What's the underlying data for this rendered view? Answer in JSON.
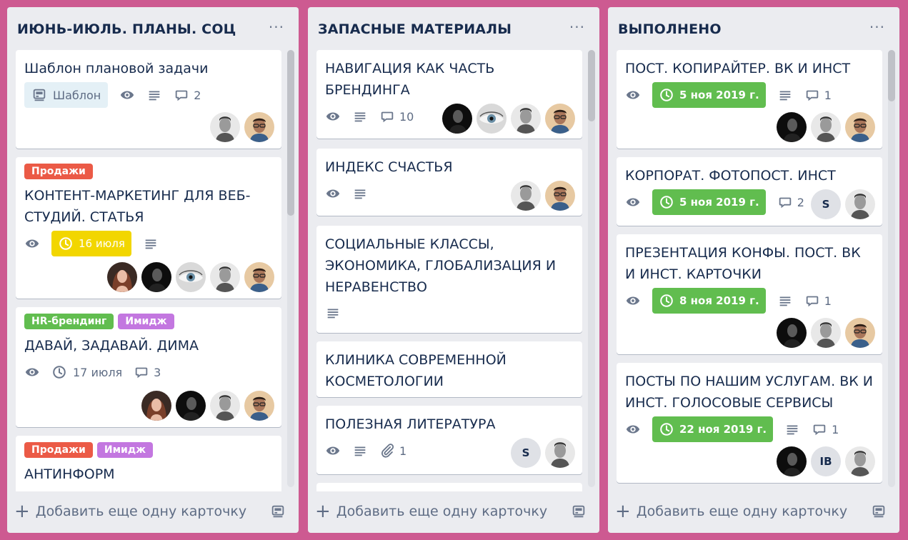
{
  "lists": [
    {
      "title": "ИЮНЬ-ИЮЛЬ. ПЛАНЫ. СОЦ",
      "menu": "···",
      "add_card": "Добавить еще одну карточку",
      "cards": [
        {
          "title": "Шаблон плановой задачи",
          "template_label": "Шаблон",
          "comments": "2"
        },
        {
          "label": "Продажи",
          "title": "КОНТЕНТ-МАРКЕТИНГ ДЛЯ ВЕБ-СТУДИЙ. СТАТЬЯ",
          "due": "16 июля"
        },
        {
          "labels": [
            "HR-брендинг",
            "Имидж"
          ],
          "title": "ДАВАЙ, ЗАДАВАЙ. ДИМА",
          "due": "17 июля",
          "comments": "3"
        },
        {
          "labels": [
            "Продажи",
            "Имидж"
          ],
          "title": "АНТИНФОРМ"
        }
      ]
    },
    {
      "title": "ЗАПАСНЫЕ МАТЕРИАЛЫ",
      "menu": "···",
      "add_card": "Добавить еще одну карточку",
      "cards": [
        {
          "title": "НАВИГАЦИЯ КАК ЧАСТЬ БРЕНДИНГА",
          "comments": "10"
        },
        {
          "title": "ИНДЕКС СЧАСТЬЯ"
        },
        {
          "title": "СОЦИАЛЬНЫЕ КЛАССЫ, ЭКОНОМИКА, ГЛОБАЛИЗАЦИЯ И НЕРАВЕНСТВО"
        },
        {
          "title": "КЛИНИКА СОВРЕМЕННОЙ КОСМЕТОЛОГИИ"
        },
        {
          "title": "ПОЛЕЗНАЯ ЛИТЕРАТУРА",
          "attachments": "1",
          "member_initial": "S"
        }
      ]
    },
    {
      "title": "ВЫПОЛНЕНО",
      "menu": "···",
      "add_card": "Добавить еще одну карточку",
      "cards": [
        {
          "title": "ПОСТ. КОПИРАЙТЕР. ВК И ИНСТ",
          "due": "5 ноя 2019 г.",
          "comments": "1"
        },
        {
          "title": "КОРПОРАТ. ФОТОПОСТ. ИНСТ",
          "due": "5 ноя 2019 г.",
          "comments": "2",
          "member_initial": "S"
        },
        {
          "title": "ПРЕЗЕНТАЦИЯ КОНФЫ. ПОСТ. ВК И ИНСТ. КАРТОЧКИ",
          "due": "8 ноя 2019 г.",
          "comments": "1"
        },
        {
          "title": "ПОСТЫ ПО НАШИМ УСЛУГАМ. ВК И ИНСТ. ГОЛОСОВЫЕ СЕРВИСЫ",
          "due": "22 ноя 2019 г.",
          "comments": "1",
          "member_initial": "IB"
        }
      ]
    }
  ],
  "colors": {
    "board_bg": "#cd5a91",
    "list_bg": "#ebecf0",
    "label_red": "#eb5a46",
    "label_green": "#61bd4f",
    "label_purple": "#c377e0",
    "due_yellow": "#f2d600",
    "due_green": "#61bd4f"
  },
  "icons": [
    "eye-icon",
    "description-icon",
    "comment-icon",
    "clock-icon",
    "attachment-icon",
    "template-icon",
    "plus-icon",
    "card-template-icon",
    "more-icon"
  ]
}
